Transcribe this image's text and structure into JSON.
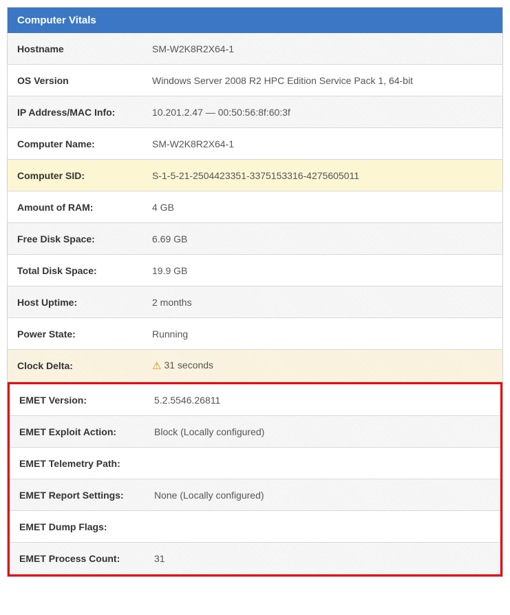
{
  "panel": {
    "title": "Computer Vitals"
  },
  "rows": {
    "hostname": {
      "label": "Hostname",
      "value": "SM-W2K8R2X64-1"
    },
    "os_version": {
      "label": "OS Version",
      "value": "Windows Server 2008 R2 HPC Edition Service Pack 1, 64-bit"
    },
    "ip_mac": {
      "label": "IP Address/MAC Info:",
      "value": "10.201.2.47 — 00:50:56:8f:60:3f"
    },
    "computer_name": {
      "label": "Computer Name:",
      "value": "SM-W2K8R2X64-1"
    },
    "computer_sid": {
      "label": "Computer SID:",
      "value": "S-1-5-21-2504423351-3375153316-4275605011"
    },
    "ram": {
      "label": "Amount of RAM:",
      "value": "4 GB"
    },
    "free_disk": {
      "label": "Free Disk Space:",
      "value": "6.69 GB"
    },
    "total_disk": {
      "label": "Total Disk Space:",
      "value": "19.9 GB"
    },
    "uptime": {
      "label": "Host Uptime:",
      "value": "2 months"
    },
    "power": {
      "label": "Power State:",
      "value": "Running"
    },
    "clock": {
      "label": "Clock Delta:",
      "value": "31 seconds"
    },
    "emet_version": {
      "label": "EMET Version:",
      "value": "5.2.5546.26811"
    },
    "emet_exploit": {
      "label": "EMET Exploit Action:",
      "value": "Block (Locally configured)"
    },
    "emet_telemetry": {
      "label": "EMET Telemetry Path:",
      "value": ""
    },
    "emet_report": {
      "label": "EMET Report Settings:",
      "value": "None (Locally configured)"
    },
    "emet_dump": {
      "label": "EMET Dump Flags:",
      "value": ""
    },
    "emet_process": {
      "label": "EMET Process Count:",
      "value": "31"
    }
  },
  "icons": {
    "warning": "⚠"
  }
}
